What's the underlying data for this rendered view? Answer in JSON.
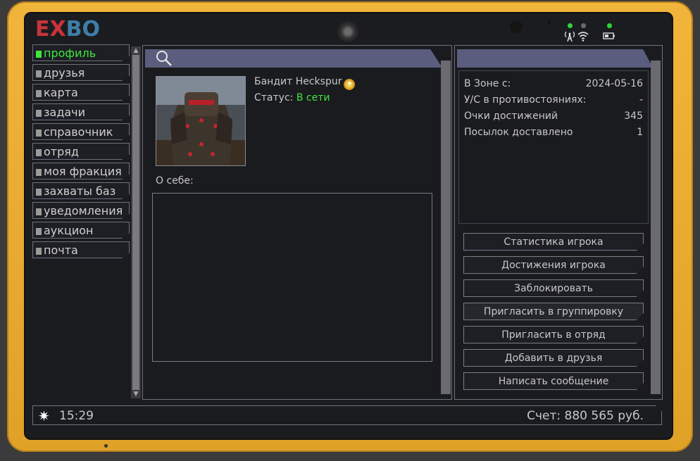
{
  "brand": {
    "logo_ex": "EX",
    "logo_bo": "BO"
  },
  "sidebar": {
    "items": [
      {
        "label": "профиль",
        "active": true
      },
      {
        "label": "друзья"
      },
      {
        "label": "карта"
      },
      {
        "label": "задачи"
      },
      {
        "label": "справочник"
      },
      {
        "label": "отряд"
      },
      {
        "label": "моя фракция"
      },
      {
        "label": "захваты баз"
      },
      {
        "label": "уведомления"
      },
      {
        "label": "аукцион"
      },
      {
        "label": "почта"
      }
    ]
  },
  "profile": {
    "name": "Бандит Heckspur",
    "status_label": "Статус:",
    "status_value": "В сети",
    "about_label": "О себе:",
    "about_text": ""
  },
  "stats": {
    "rows": [
      {
        "label": "В Зоне с:",
        "value": "2024-05-16"
      },
      {
        "label": "У/С в противостояниях:",
        "value": "-"
      },
      {
        "label": "Очки достижений",
        "value": "345"
      },
      {
        "label": "Посылок доставлено",
        "value": "1"
      }
    ]
  },
  "actions": [
    {
      "label": "Статистика игрока"
    },
    {
      "label": "Достижения игрока"
    },
    {
      "label": "Заблокировать"
    },
    {
      "label": "Пригласить в группировку"
    },
    {
      "label": "Пригласить в отряд"
    },
    {
      "label": "Добавить в друзья"
    },
    {
      "label": "Написать сообщение"
    }
  ],
  "footer": {
    "time": "15:29",
    "balance": "Счет: 880 565 руб."
  },
  "colors": {
    "accent_green": "#3ee640",
    "header_bar": "#5b5d7e",
    "bezel": "#e8ab31"
  }
}
